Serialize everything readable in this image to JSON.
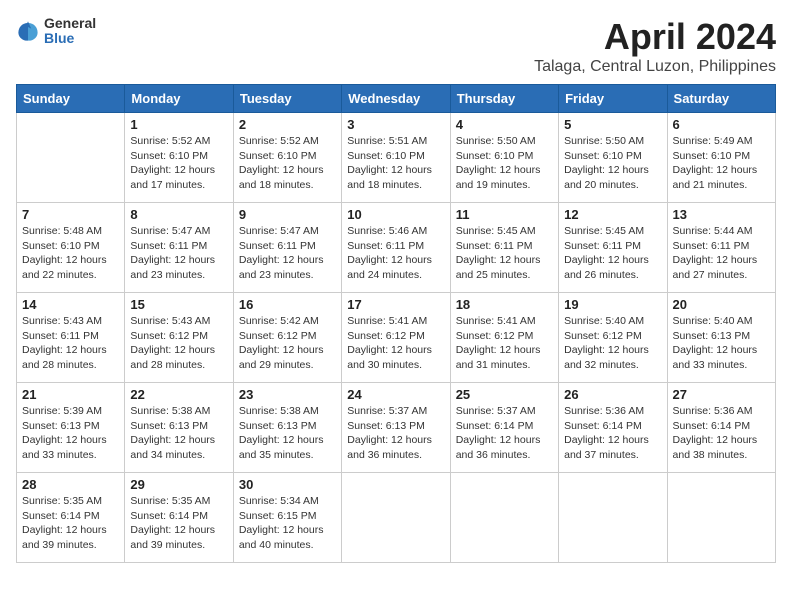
{
  "logo": {
    "general": "General",
    "blue": "Blue"
  },
  "title": "April 2024",
  "location": "Talaga, Central Luzon, Philippines",
  "weekdays": [
    "Sunday",
    "Monday",
    "Tuesday",
    "Wednesday",
    "Thursday",
    "Friday",
    "Saturday"
  ],
  "weeks": [
    [
      {
        "day": "",
        "info": ""
      },
      {
        "day": "1",
        "info": "Sunrise: 5:52 AM\nSunset: 6:10 PM\nDaylight: 12 hours\nand 17 minutes."
      },
      {
        "day": "2",
        "info": "Sunrise: 5:52 AM\nSunset: 6:10 PM\nDaylight: 12 hours\nand 18 minutes."
      },
      {
        "day": "3",
        "info": "Sunrise: 5:51 AM\nSunset: 6:10 PM\nDaylight: 12 hours\nand 18 minutes."
      },
      {
        "day": "4",
        "info": "Sunrise: 5:50 AM\nSunset: 6:10 PM\nDaylight: 12 hours\nand 19 minutes."
      },
      {
        "day": "5",
        "info": "Sunrise: 5:50 AM\nSunset: 6:10 PM\nDaylight: 12 hours\nand 20 minutes."
      },
      {
        "day": "6",
        "info": "Sunrise: 5:49 AM\nSunset: 6:10 PM\nDaylight: 12 hours\nand 21 minutes."
      }
    ],
    [
      {
        "day": "7",
        "info": "Sunrise: 5:48 AM\nSunset: 6:10 PM\nDaylight: 12 hours\nand 22 minutes."
      },
      {
        "day": "8",
        "info": "Sunrise: 5:47 AM\nSunset: 6:11 PM\nDaylight: 12 hours\nand 23 minutes."
      },
      {
        "day": "9",
        "info": "Sunrise: 5:47 AM\nSunset: 6:11 PM\nDaylight: 12 hours\nand 23 minutes."
      },
      {
        "day": "10",
        "info": "Sunrise: 5:46 AM\nSunset: 6:11 PM\nDaylight: 12 hours\nand 24 minutes."
      },
      {
        "day": "11",
        "info": "Sunrise: 5:45 AM\nSunset: 6:11 PM\nDaylight: 12 hours\nand 25 minutes."
      },
      {
        "day": "12",
        "info": "Sunrise: 5:45 AM\nSunset: 6:11 PM\nDaylight: 12 hours\nand 26 minutes."
      },
      {
        "day": "13",
        "info": "Sunrise: 5:44 AM\nSunset: 6:11 PM\nDaylight: 12 hours\nand 27 minutes."
      }
    ],
    [
      {
        "day": "14",
        "info": "Sunrise: 5:43 AM\nSunset: 6:11 PM\nDaylight: 12 hours\nand 28 minutes."
      },
      {
        "day": "15",
        "info": "Sunrise: 5:43 AM\nSunset: 6:12 PM\nDaylight: 12 hours\nand 28 minutes."
      },
      {
        "day": "16",
        "info": "Sunrise: 5:42 AM\nSunset: 6:12 PM\nDaylight: 12 hours\nand 29 minutes."
      },
      {
        "day": "17",
        "info": "Sunrise: 5:41 AM\nSunset: 6:12 PM\nDaylight: 12 hours\nand 30 minutes."
      },
      {
        "day": "18",
        "info": "Sunrise: 5:41 AM\nSunset: 6:12 PM\nDaylight: 12 hours\nand 31 minutes."
      },
      {
        "day": "19",
        "info": "Sunrise: 5:40 AM\nSunset: 6:12 PM\nDaylight: 12 hours\nand 32 minutes."
      },
      {
        "day": "20",
        "info": "Sunrise: 5:40 AM\nSunset: 6:13 PM\nDaylight: 12 hours\nand 33 minutes."
      }
    ],
    [
      {
        "day": "21",
        "info": "Sunrise: 5:39 AM\nSunset: 6:13 PM\nDaylight: 12 hours\nand 33 minutes."
      },
      {
        "day": "22",
        "info": "Sunrise: 5:38 AM\nSunset: 6:13 PM\nDaylight: 12 hours\nand 34 minutes."
      },
      {
        "day": "23",
        "info": "Sunrise: 5:38 AM\nSunset: 6:13 PM\nDaylight: 12 hours\nand 35 minutes."
      },
      {
        "day": "24",
        "info": "Sunrise: 5:37 AM\nSunset: 6:13 PM\nDaylight: 12 hours\nand 36 minutes."
      },
      {
        "day": "25",
        "info": "Sunrise: 5:37 AM\nSunset: 6:14 PM\nDaylight: 12 hours\nand 36 minutes."
      },
      {
        "day": "26",
        "info": "Sunrise: 5:36 AM\nSunset: 6:14 PM\nDaylight: 12 hours\nand 37 minutes."
      },
      {
        "day": "27",
        "info": "Sunrise: 5:36 AM\nSunset: 6:14 PM\nDaylight: 12 hours\nand 38 minutes."
      }
    ],
    [
      {
        "day": "28",
        "info": "Sunrise: 5:35 AM\nSunset: 6:14 PM\nDaylight: 12 hours\nand 39 minutes."
      },
      {
        "day": "29",
        "info": "Sunrise: 5:35 AM\nSunset: 6:14 PM\nDaylight: 12 hours\nand 39 minutes."
      },
      {
        "day": "30",
        "info": "Sunrise: 5:34 AM\nSunset: 6:15 PM\nDaylight: 12 hours\nand 40 minutes."
      },
      {
        "day": "",
        "info": ""
      },
      {
        "day": "",
        "info": ""
      },
      {
        "day": "",
        "info": ""
      },
      {
        "day": "",
        "info": ""
      }
    ]
  ]
}
